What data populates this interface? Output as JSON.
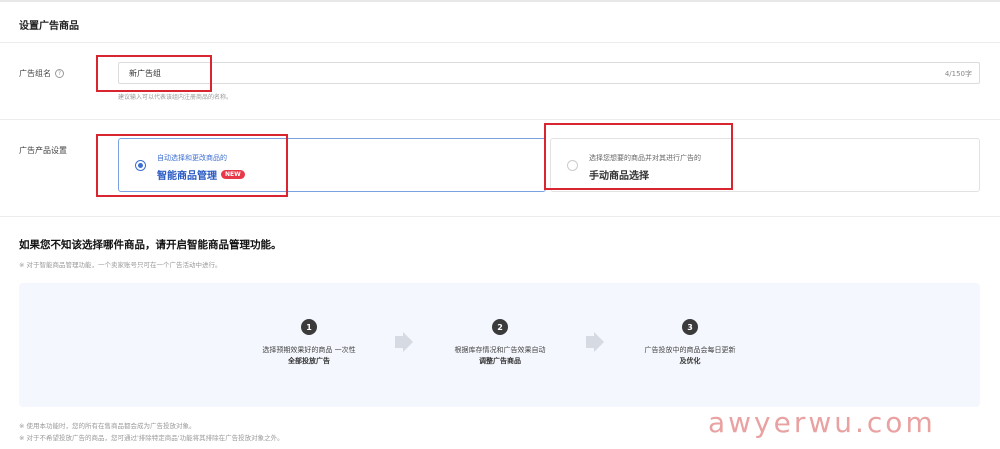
{
  "section_title": "设置广告商品",
  "ad_group_name": {
    "label": "广告组名",
    "value": "新广告组",
    "char_count": "4/150字",
    "hint": "建议输入可以代表该组内注册商品的名称。"
  },
  "product_setting": {
    "label": "广告产品设置",
    "options": [
      {
        "sub": "自动选择和更改商品的",
        "main": "智能商品管理",
        "badge": "NEW",
        "selected": true
      },
      {
        "sub": "选择您想要的商品并对其进行广告的",
        "main": "手动商品选择",
        "selected": false
      }
    ]
  },
  "info": {
    "title": "如果您不知该选择哪件商品，请开启智能商品管理功能。",
    "note": "※ 对于智能商品管理功能，一个卖家账号只可在一个广告活动中进行。"
  },
  "steps": [
    {
      "num": "1",
      "line1": "选择预期效果好的商品 一次性",
      "line2": "全部投放广告"
    },
    {
      "num": "2",
      "line1": "根据库存情况和广告效果自动",
      "line2": "调整广告商品"
    },
    {
      "num": "3",
      "line1": "广告投放中的商品会每日更新",
      "line2": "及优化"
    }
  ],
  "footnotes": [
    "※ 使用本功能时，您的所有在售商品都会成为广告投放对象。",
    "※ 对于不希望投放广告的商品，您可通过'排除特定商品'功能将其排除在广告投放对象之外。"
  ],
  "watermark": "awyerwu.com",
  "colors": {
    "accent": "#3d6fd1",
    "highlight_box": "#d9252f",
    "badge": "#e8394a"
  }
}
